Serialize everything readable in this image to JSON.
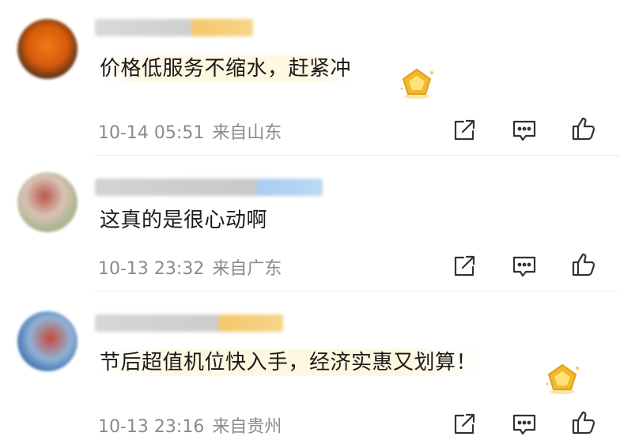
{
  "comments": [
    {
      "text": "价格低服务不缩水，赶紧冲",
      "time": "10-14 05:51",
      "location": "来自山东",
      "has_badge": true,
      "name_accent": "#f5c86a"
    },
    {
      "text": "这真的是很心动啊",
      "time": "10-13 23:32",
      "location": "来自广东",
      "has_badge": false,
      "name_accent": "#a9cdf2"
    },
    {
      "text": "节后超值机位快入手，经济实惠又划算！",
      "time": "10-13 23:16",
      "location": "来自贵州",
      "has_badge": true,
      "name_accent": "#f5c86a"
    }
  ],
  "icons": {
    "share": "share-icon",
    "comment": "comment-icon",
    "like": "like-icon",
    "badge": "fan-badge-icon"
  },
  "colors": {
    "meta_text": "#8a8a8a",
    "badge_gold": "#f2b92e"
  }
}
